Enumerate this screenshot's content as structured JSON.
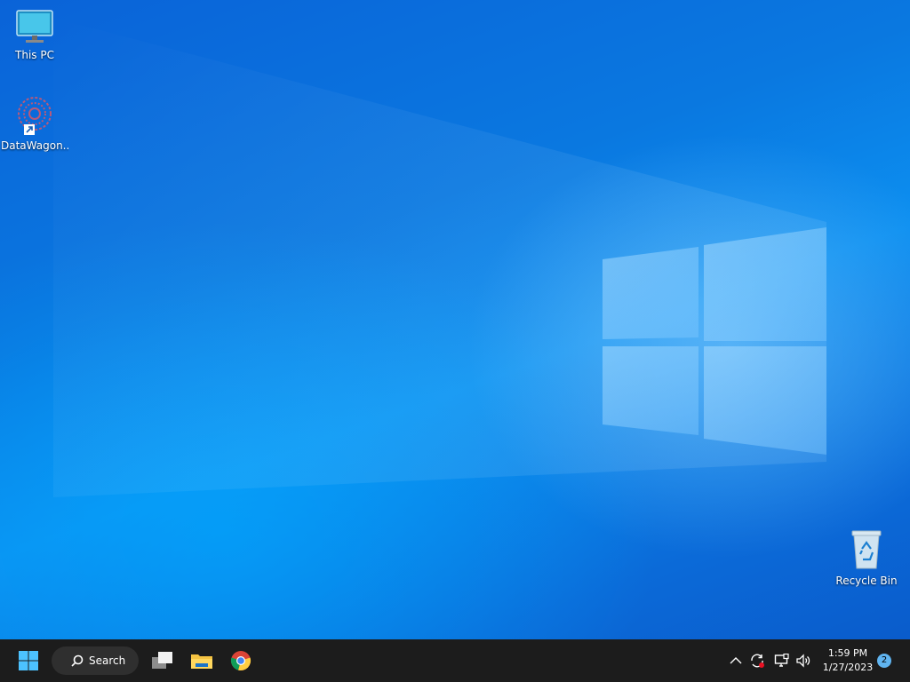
{
  "desktop": {
    "icons": [
      {
        "label": "This PC",
        "icon": "monitor-icon"
      },
      {
        "label": "DataWagon...",
        "icon": "datawagon-app-icon"
      },
      {
        "label": "Recycle Bin",
        "icon": "recycle-bin-icon"
      }
    ]
  },
  "taskbar": {
    "start_icon": "windows-start-icon",
    "search_label": "Search",
    "pinned": [
      "task-view-icon",
      "file-explorer-icon",
      "chrome-icon"
    ],
    "tray": {
      "chevron": "show-hidden-icons-icon",
      "sync": "sync-icon",
      "network": "network-icon",
      "volume": "volume-icon",
      "time": "1:59 PM",
      "date": "1/27/2023",
      "notification_count": "2"
    }
  },
  "colors": {
    "taskbar_bg": "#1c1c1c",
    "wallpaper_blue": "#0a78e0",
    "accent": "#60b4f0"
  }
}
